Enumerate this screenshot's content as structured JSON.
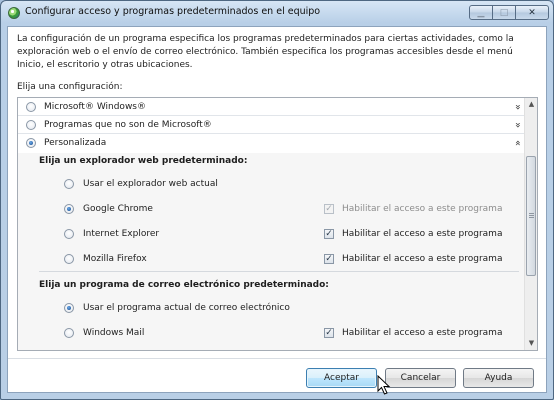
{
  "window": {
    "title": "Configurar acceso y programas predeterminados en el equipo",
    "buttons": {
      "minimize": "▁",
      "maximize": "□",
      "close": "✕"
    }
  },
  "description": "La configuración de un programa especifica los programas predeterminados para ciertas actividades, como la exploración web o el envío de correo electrónico. También especifica los programas accesibles desde el menú Inicio, el escritorio y otras ubicaciones.",
  "choose_label": "Elija una configuración:",
  "configurations": [
    {
      "label": "Microsoft® Windows®",
      "selected": false,
      "expander": "»"
    },
    {
      "label": "Programas que no son de Microsoft®",
      "selected": false,
      "expander": "»"
    },
    {
      "label": "Personalizada",
      "selected": true,
      "expander": "«"
    }
  ],
  "browser_section": {
    "title": "Elija un explorador web predeterminado:",
    "options": [
      {
        "label": "Usar el explorador web actual",
        "selected": false,
        "check": null
      },
      {
        "label": "Google Chrome",
        "selected": true,
        "check": {
          "label": "Habilitar el acceso a este programa",
          "checked": true,
          "disabled": true
        }
      },
      {
        "label": "Internet Explorer",
        "selected": false,
        "check": {
          "label": "Habilitar el acceso a este programa",
          "checked": true,
          "disabled": false
        }
      },
      {
        "label": "Mozilla Firefox",
        "selected": false,
        "check": {
          "label": "Habilitar el acceso a este programa",
          "checked": true,
          "disabled": false
        }
      }
    ]
  },
  "mail_section": {
    "title": "Elija un programa de correo electrónico predeterminado:",
    "options": [
      {
        "label": "Usar el programa actual de correo electrónico",
        "selected": true,
        "check": null
      },
      {
        "label": "Windows Mail",
        "selected": false,
        "check": {
          "label": "Habilitar el acceso a este programa",
          "checked": true,
          "disabled": false
        }
      }
    ]
  },
  "check_mark": "✓",
  "scroll_arrows": {
    "up": "▲",
    "down": "▼"
  },
  "footer": {
    "accept": "Aceptar",
    "cancel": "Cancelar",
    "help": "Ayuda"
  },
  "colors": {
    "accent": "#3c7fb1",
    "titlebar": "#b9cfe6",
    "panel": "#f6f6f6"
  }
}
